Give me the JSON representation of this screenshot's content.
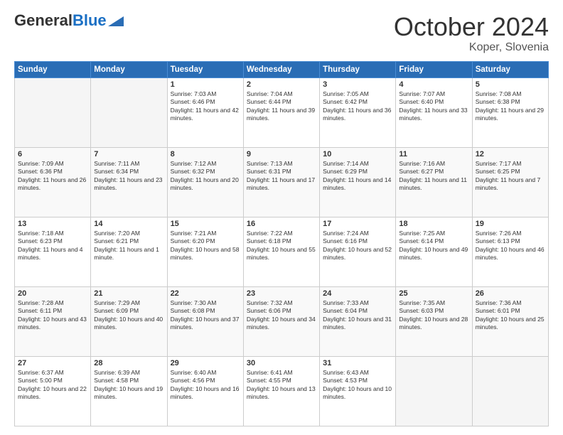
{
  "header": {
    "logo_general": "General",
    "logo_blue": "Blue",
    "month_title": "October 2024",
    "location": "Koper, Slovenia"
  },
  "days_of_week": [
    "Sunday",
    "Monday",
    "Tuesday",
    "Wednesday",
    "Thursday",
    "Friday",
    "Saturday"
  ],
  "weeks": [
    [
      {
        "day": null
      },
      {
        "day": null
      },
      {
        "day": "1",
        "sunrise": "Sunrise: 7:03 AM",
        "sunset": "Sunset: 6:46 PM",
        "daylight": "Daylight: 11 hours and 42 minutes."
      },
      {
        "day": "2",
        "sunrise": "Sunrise: 7:04 AM",
        "sunset": "Sunset: 6:44 PM",
        "daylight": "Daylight: 11 hours and 39 minutes."
      },
      {
        "day": "3",
        "sunrise": "Sunrise: 7:05 AM",
        "sunset": "Sunset: 6:42 PM",
        "daylight": "Daylight: 11 hours and 36 minutes."
      },
      {
        "day": "4",
        "sunrise": "Sunrise: 7:07 AM",
        "sunset": "Sunset: 6:40 PM",
        "daylight": "Daylight: 11 hours and 33 minutes."
      },
      {
        "day": "5",
        "sunrise": "Sunrise: 7:08 AM",
        "sunset": "Sunset: 6:38 PM",
        "daylight": "Daylight: 11 hours and 29 minutes."
      }
    ],
    [
      {
        "day": "6",
        "sunrise": "Sunrise: 7:09 AM",
        "sunset": "Sunset: 6:36 PM",
        "daylight": "Daylight: 11 hours and 26 minutes."
      },
      {
        "day": "7",
        "sunrise": "Sunrise: 7:11 AM",
        "sunset": "Sunset: 6:34 PM",
        "daylight": "Daylight: 11 hours and 23 minutes."
      },
      {
        "day": "8",
        "sunrise": "Sunrise: 7:12 AM",
        "sunset": "Sunset: 6:32 PM",
        "daylight": "Daylight: 11 hours and 20 minutes."
      },
      {
        "day": "9",
        "sunrise": "Sunrise: 7:13 AM",
        "sunset": "Sunset: 6:31 PM",
        "daylight": "Daylight: 11 hours and 17 minutes."
      },
      {
        "day": "10",
        "sunrise": "Sunrise: 7:14 AM",
        "sunset": "Sunset: 6:29 PM",
        "daylight": "Daylight: 11 hours and 14 minutes."
      },
      {
        "day": "11",
        "sunrise": "Sunrise: 7:16 AM",
        "sunset": "Sunset: 6:27 PM",
        "daylight": "Daylight: 11 hours and 11 minutes."
      },
      {
        "day": "12",
        "sunrise": "Sunrise: 7:17 AM",
        "sunset": "Sunset: 6:25 PM",
        "daylight": "Daylight: 11 hours and 7 minutes."
      }
    ],
    [
      {
        "day": "13",
        "sunrise": "Sunrise: 7:18 AM",
        "sunset": "Sunset: 6:23 PM",
        "daylight": "Daylight: 11 hours and 4 minutes."
      },
      {
        "day": "14",
        "sunrise": "Sunrise: 7:20 AM",
        "sunset": "Sunset: 6:21 PM",
        "daylight": "Daylight: 11 hours and 1 minute."
      },
      {
        "day": "15",
        "sunrise": "Sunrise: 7:21 AM",
        "sunset": "Sunset: 6:20 PM",
        "daylight": "Daylight: 10 hours and 58 minutes."
      },
      {
        "day": "16",
        "sunrise": "Sunrise: 7:22 AM",
        "sunset": "Sunset: 6:18 PM",
        "daylight": "Daylight: 10 hours and 55 minutes."
      },
      {
        "day": "17",
        "sunrise": "Sunrise: 7:24 AM",
        "sunset": "Sunset: 6:16 PM",
        "daylight": "Daylight: 10 hours and 52 minutes."
      },
      {
        "day": "18",
        "sunrise": "Sunrise: 7:25 AM",
        "sunset": "Sunset: 6:14 PM",
        "daylight": "Daylight: 10 hours and 49 minutes."
      },
      {
        "day": "19",
        "sunrise": "Sunrise: 7:26 AM",
        "sunset": "Sunset: 6:13 PM",
        "daylight": "Daylight: 10 hours and 46 minutes."
      }
    ],
    [
      {
        "day": "20",
        "sunrise": "Sunrise: 7:28 AM",
        "sunset": "Sunset: 6:11 PM",
        "daylight": "Daylight: 10 hours and 43 minutes."
      },
      {
        "day": "21",
        "sunrise": "Sunrise: 7:29 AM",
        "sunset": "Sunset: 6:09 PM",
        "daylight": "Daylight: 10 hours and 40 minutes."
      },
      {
        "day": "22",
        "sunrise": "Sunrise: 7:30 AM",
        "sunset": "Sunset: 6:08 PM",
        "daylight": "Daylight: 10 hours and 37 minutes."
      },
      {
        "day": "23",
        "sunrise": "Sunrise: 7:32 AM",
        "sunset": "Sunset: 6:06 PM",
        "daylight": "Daylight: 10 hours and 34 minutes."
      },
      {
        "day": "24",
        "sunrise": "Sunrise: 7:33 AM",
        "sunset": "Sunset: 6:04 PM",
        "daylight": "Daylight: 10 hours and 31 minutes."
      },
      {
        "day": "25",
        "sunrise": "Sunrise: 7:35 AM",
        "sunset": "Sunset: 6:03 PM",
        "daylight": "Daylight: 10 hours and 28 minutes."
      },
      {
        "day": "26",
        "sunrise": "Sunrise: 7:36 AM",
        "sunset": "Sunset: 6:01 PM",
        "daylight": "Daylight: 10 hours and 25 minutes."
      }
    ],
    [
      {
        "day": "27",
        "sunrise": "Sunrise: 6:37 AM",
        "sunset": "Sunset: 5:00 PM",
        "daylight": "Daylight: 10 hours and 22 minutes."
      },
      {
        "day": "28",
        "sunrise": "Sunrise: 6:39 AM",
        "sunset": "Sunset: 4:58 PM",
        "daylight": "Daylight: 10 hours and 19 minutes."
      },
      {
        "day": "29",
        "sunrise": "Sunrise: 6:40 AM",
        "sunset": "Sunset: 4:56 PM",
        "daylight": "Daylight: 10 hours and 16 minutes."
      },
      {
        "day": "30",
        "sunrise": "Sunrise: 6:41 AM",
        "sunset": "Sunset: 4:55 PM",
        "daylight": "Daylight: 10 hours and 13 minutes."
      },
      {
        "day": "31",
        "sunrise": "Sunrise: 6:43 AM",
        "sunset": "Sunset: 4:53 PM",
        "daylight": "Daylight: 10 hours and 10 minutes."
      },
      {
        "day": null
      },
      {
        "day": null
      }
    ]
  ]
}
